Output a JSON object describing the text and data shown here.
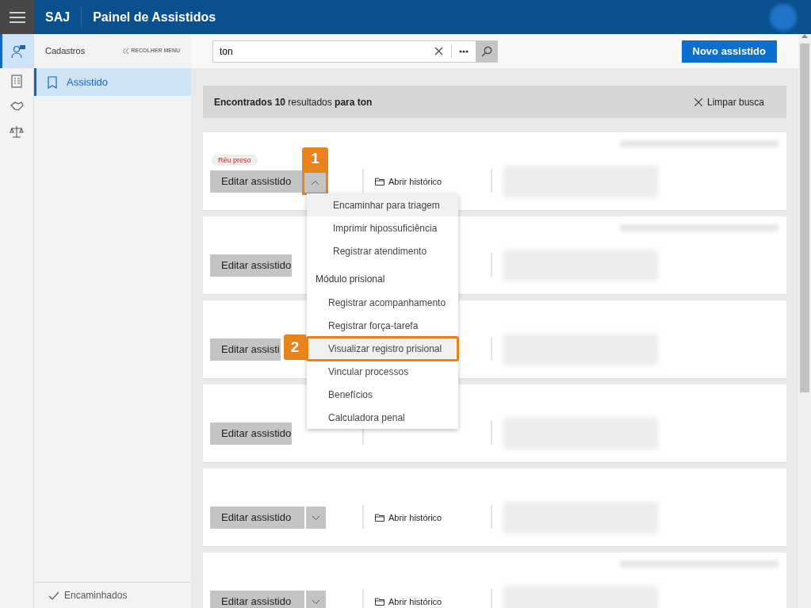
{
  "header": {
    "brand": "SAJ",
    "title": "Painel de Assistidos"
  },
  "rail": [
    {
      "selected": true
    },
    {
      "selected": false
    },
    {
      "selected": false
    },
    {
      "selected": false
    }
  ],
  "sidebar": {
    "title": "Cadastros",
    "collapse": "RECOLHER MENU",
    "items": [
      {
        "label": "Assistido",
        "selected": true
      }
    ],
    "footer": "Encaminhados"
  },
  "search": {
    "value": "ton"
  },
  "new_button": "Novo assistido",
  "results": {
    "text": "**Encontrados 10** resultados **para ton**",
    "clear": "Limpar busca"
  },
  "cards": [
    {
      "tag": "Réu preso",
      "edit": "Editar assistido",
      "toggle": {
        "expanded": true,
        "callout": "1"
      },
      "history": "Abrir histórico",
      "top_blur": true
    },
    {
      "edit": "Editar assistido",
      "top_blur": true
    },
    {
      "edit": "Editar assisti",
      "top_blur": false
    },
    {
      "edit": "Editar assistido",
      "top_blur": false
    },
    {
      "edit": "Editar assistido",
      "toggle": {
        "expanded": false
      },
      "history": "Abrir histórico",
      "top_blur": false
    },
    {
      "edit": "Editar assistido",
      "toggle": {
        "expanded": false
      },
      "history": "Abrir histórico",
      "top_blur": true
    }
  ],
  "menu": [
    {
      "kind": "item",
      "label": "Encaminhar para triagem",
      "highlighted": true
    },
    {
      "kind": "item",
      "label": "Imprimir hipossuficiência",
      "highlighted": false
    },
    {
      "kind": "item",
      "label": "Registrar atendimento",
      "highlighted": false
    },
    {
      "kind": "header",
      "label": "Módulo prisional"
    },
    {
      "kind": "subitem",
      "label": "Registrar acompanhamento",
      "highlighted": false
    },
    {
      "kind": "subitem",
      "label": "Registrar força-tarefa",
      "highlighted": false
    },
    {
      "kind": "subitem",
      "label": "Visualizar registro prisional",
      "highlighted": true,
      "callout": "2"
    },
    {
      "kind": "subitem",
      "label": "Vincular processos",
      "highlighted": false
    },
    {
      "kind": "subitem",
      "label": "Benefícios",
      "highlighted": false
    },
    {
      "kind": "subitem",
      "label": "Calculadora penal",
      "highlighted": false
    }
  ]
}
